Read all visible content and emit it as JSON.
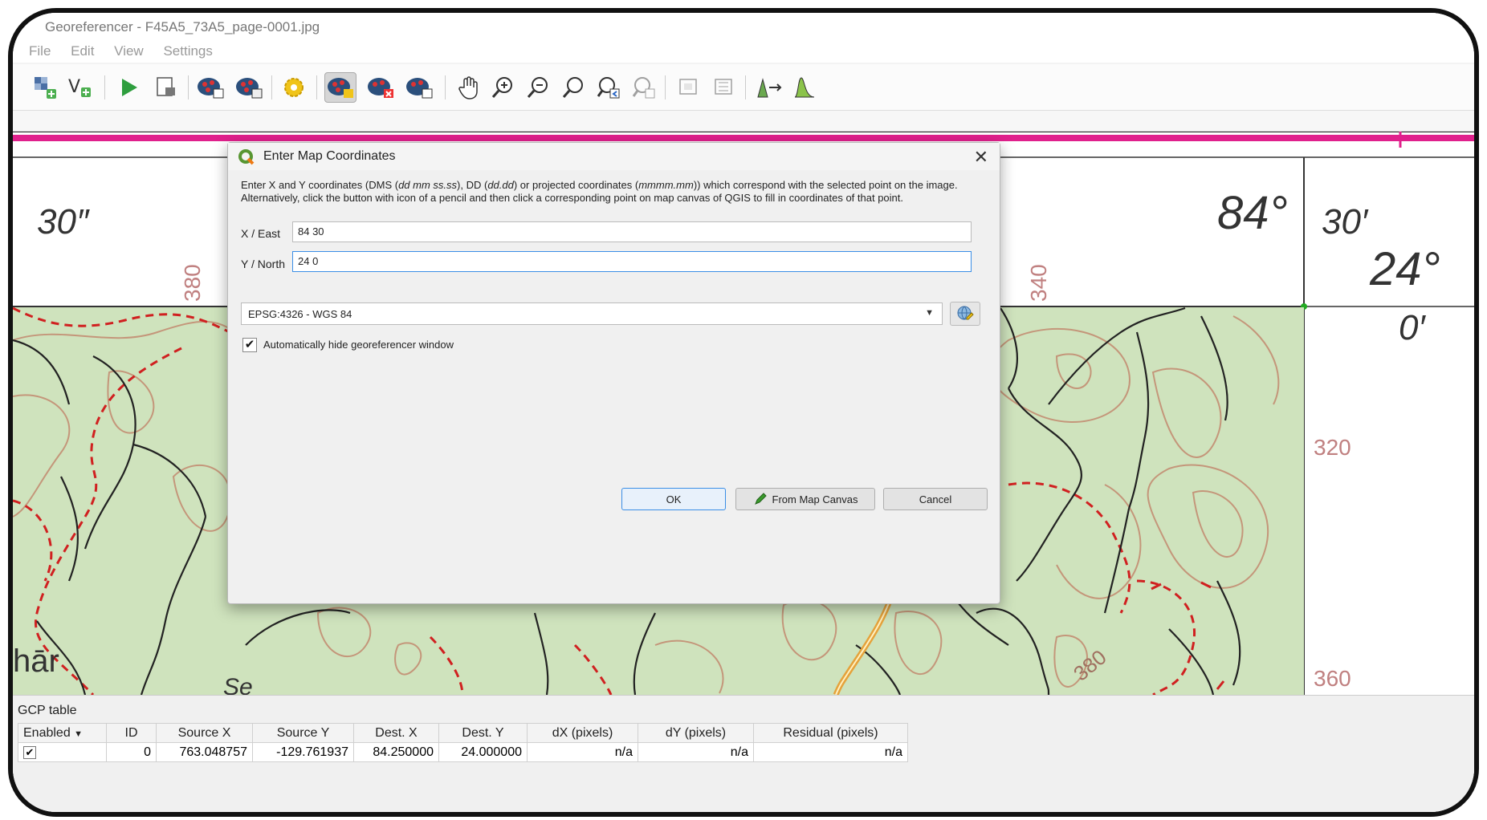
{
  "window": {
    "title": "Georeferencer - F45A5_73A5_page-0001.jpg"
  },
  "menu": [
    "File",
    "Edit",
    "View",
    "Settings"
  ],
  "toolbar": {
    "icons": [
      "open-raster-icon",
      "start-georeferencing-icon",
      "generate-gdal-script-icon",
      "load-gcp-icon",
      "save-gcp-icon",
      "transformation-settings-icon",
      "add-point-icon",
      "delete-point-icon",
      "move-gcp-icon",
      "pan-icon",
      "zoom-in-icon",
      "zoom-out-icon",
      "zoom-to-layer-icon",
      "zoom-last-icon",
      "zoom-next-icon",
      "link-georeferencer-icon",
      "link-qgis-icon",
      "full-histogram-stretch-icon",
      "local-histogram-stretch-icon"
    ],
    "active": "add-point-icon"
  },
  "map": {
    "labels": {
      "sec_left": "30″",
      "deg_right": "84°",
      "min_right": "30′",
      "lat_deg": "24°",
      "lat_min": "0′",
      "place": "hār",
      "place2": "Se"
    },
    "tick_labels": [
      "380",
      "340",
      "320",
      "360",
      "380"
    ],
    "colors": {
      "neatline": "#e0208c",
      "map_fill": "#cfe3bd",
      "contour": "#c4967a",
      "trail": "#d02020",
      "stream": "#222222"
    }
  },
  "dialog": {
    "title": "Enter Map Coordinates",
    "description_parts": {
      "p1": "Enter X and Y coordinates (DMS (",
      "i1": "dd mm ss.ss",
      "p2": "), DD (",
      "i2": "dd.dd",
      "p3": ") or projected coordinates (",
      "i3": "mmmm.mm",
      "p4": ")) which correspond with the selected point on the image. Alternatively, click the button with icon of a pencil and then click a corresponding point on map canvas of QGIS to fill in coordinates of that point."
    },
    "x_label": "X / East",
    "x_value": "84 30",
    "y_label": "Y / North",
    "y_value": "24 0",
    "crs": "EPSG:4326 - WGS 84",
    "auto_hide_label": "Automatically hide georeferencer window",
    "auto_hide_checked": true,
    "ok_label": "OK",
    "from_canvas_label": "From Map Canvas",
    "cancel_label": "Cancel"
  },
  "gcp_table": {
    "title": "GCP table",
    "columns": [
      "Enabled",
      "ID",
      "Source X",
      "Source Y",
      "Dest. X",
      "Dest. Y",
      "dX (pixels)",
      "dY (pixels)",
      "Residual (pixels)"
    ],
    "rows": [
      {
        "enabled": true,
        "id": "0",
        "source_x": "763.048757",
        "source_y": "-129.761937",
        "dest_x": "84.250000",
        "dest_y": "24.000000",
        "dx": "n/a",
        "dy": "n/a",
        "residual": "n/a"
      }
    ]
  }
}
